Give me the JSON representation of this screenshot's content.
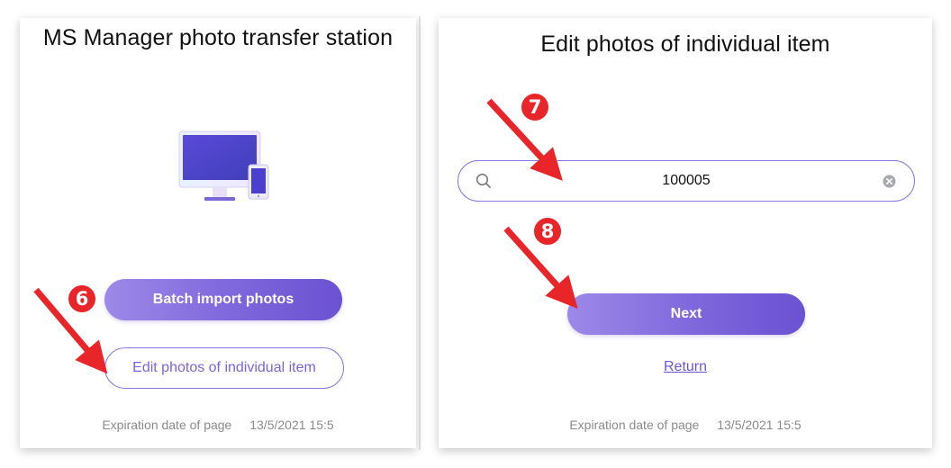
{
  "left_panel": {
    "title": "MS Manager photo transfer station",
    "batch_button": "Batch import photos",
    "edit_button": "Edit photos of individual item",
    "footer_label": "Expiration date of page",
    "footer_date": "13/5/2021 15:5"
  },
  "right_panel": {
    "title": "Edit photos of individual item",
    "search": {
      "value": "100005"
    },
    "next_button": "Next",
    "return_link": "Return",
    "footer_label": "Expiration date of page",
    "footer_date": "13/5/2021 15:5"
  },
  "annotations": [
    {
      "number": "6",
      "color": "#e8262a"
    },
    {
      "number": "7",
      "color": "#e8262a"
    },
    {
      "number": "8",
      "color": "#e8262a"
    }
  ],
  "colors": {
    "accent": "#7e66dc",
    "accent_light": "#9d89e8",
    "annotation_red": "#e8262a",
    "footer_text": "#8a8a8a"
  },
  "icons": [
    "computer-phone-illustration",
    "search-icon",
    "clear-icon",
    "arrow-icon"
  ]
}
